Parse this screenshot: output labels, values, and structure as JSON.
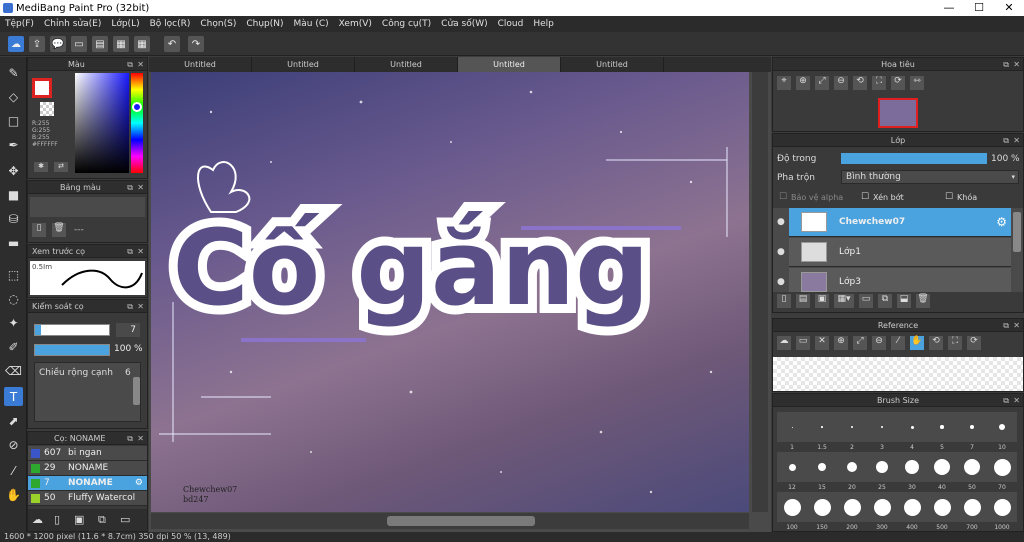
{
  "window": {
    "title": "MediBang Paint Pro (32bit)"
  },
  "menu": [
    "Tệp(F)",
    "Chỉnh sửa(E)",
    "Lớp(L)",
    "Bộ lọc(R)",
    "Chọn(S)",
    "Chụp(N)",
    "Màu (C)",
    "Xem(V)",
    "Công cụ(T)",
    "Cửa số(W)",
    "Cloud",
    "Help"
  ],
  "color_panel": {
    "title": "Màu",
    "r": "R:255",
    "g": "G:255",
    "b": "B:255",
    "hex": "#FFFFFF"
  },
  "palette_panel": {
    "title": "Bảng màu",
    "value": "---"
  },
  "brush_preview": {
    "title": "Xem trước cọ",
    "size": "0.5Im"
  },
  "brush_control": {
    "title": "Kiểm soát cọ",
    "size": "7",
    "opacity": "100 %",
    "width_label": "Chiều rộng cạnh",
    "width_value": "6"
  },
  "brush_list": {
    "title": "Cọ: NONAME",
    "items": [
      {
        "size": "607",
        "name": "bi ngan",
        "color": "#3b56c9"
      },
      {
        "size": "29",
        "name": "NONAME",
        "color": "#2ea82e"
      },
      {
        "size": "7",
        "name": "NONAME",
        "color": "#2ea82e"
      },
      {
        "size": "50",
        "name": "Fluffy Watercol",
        "color": "#9bd22a"
      }
    ]
  },
  "tabs": [
    "Untitled",
    "Untitled",
    "Untitled",
    "Untitled",
    "Untitled"
  ],
  "canvas": {
    "text": "Cố gắng",
    "watermark_line1": "Chewchew07",
    "watermark_line2": "bd247"
  },
  "navigator": {
    "title": "Hoa tiêu"
  },
  "layer_panel": {
    "title": "Lớp",
    "opacity_label": "Độ trong",
    "opacity_value": "100 %",
    "blend_label": "Pha trộn",
    "blend_value": "Bình thường",
    "protect_alpha": "Bảo vệ alpha",
    "clip": "Xén bớt",
    "lock": "Khóa",
    "layers": [
      "Chewchew07",
      "Lớp1",
      "Lớp3"
    ]
  },
  "reference_panel": {
    "title": "Reference"
  },
  "brush_size_panel": {
    "title": "Brush Size",
    "sizes": [
      "1",
      "1.5",
      "2",
      "3",
      "4",
      "5",
      "7",
      "10",
      "12",
      "15",
      "20",
      "25",
      "30",
      "40",
      "50",
      "70",
      "100",
      "150",
      "200",
      "300",
      "400",
      "500",
      "700",
      "1000"
    ]
  },
  "status": {
    "text": "1600 * 1200 pixel   (11.6 * 8.7cm)  350 dpi  50 %   (13, 489)"
  }
}
